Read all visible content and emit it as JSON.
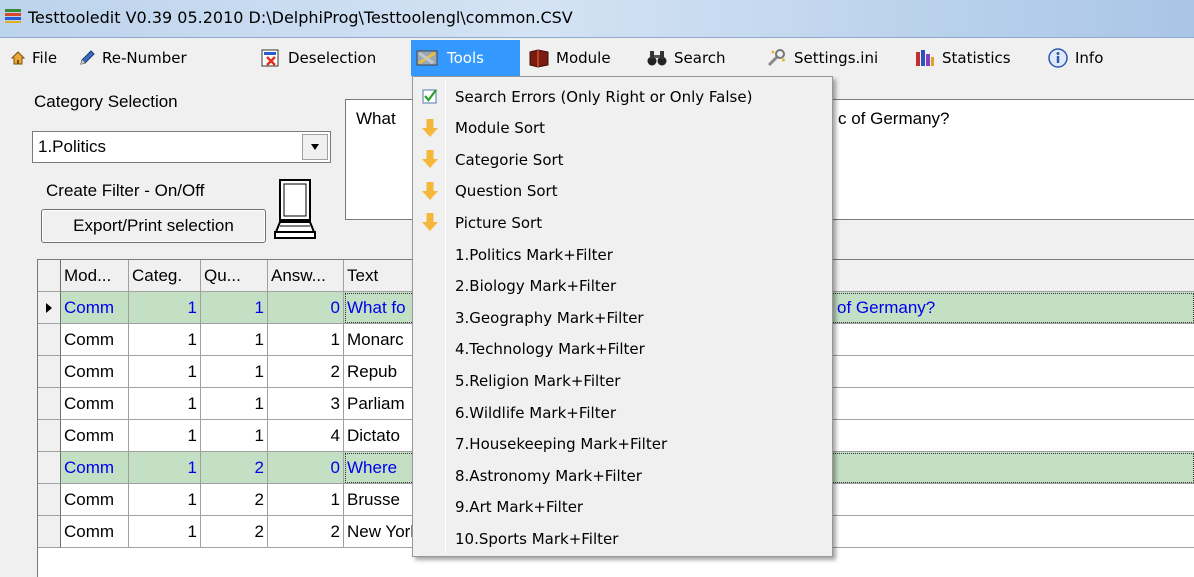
{
  "window": {
    "title": "Testtooledit V0.39 05.2010 D:\\DelphiProg\\Testtoolengl\\common.CSV"
  },
  "menu": {
    "file": "File",
    "renumber": "Re-Number",
    "deselection": "Deselection",
    "tools": "Tools",
    "module": "Module",
    "search": "Search",
    "settings": "Settings.ini",
    "statistics": "Statistics",
    "info": "Info"
  },
  "left_panel": {
    "category_label": "Category Selection",
    "category_value": "1.Politics",
    "filter_label": "Create Filter - On/Off",
    "export_button": "Export/Print selection"
  },
  "question_memo": {
    "text_left": "What",
    "text_right": "c of Germany?"
  },
  "grid": {
    "headers": {
      "module": "Mod...",
      "category": "Categ.",
      "question": "Qu...",
      "answer": "Answ...",
      "text": "Text"
    },
    "rows": [
      {
        "module": "Comm",
        "category": "1",
        "question": "1",
        "answer": "0",
        "text": "What fo",
        "text_tail": "of Germany?",
        "highlight": true,
        "current": true
      },
      {
        "module": "Comm",
        "category": "1",
        "question": "1",
        "answer": "1",
        "text": "Monarc",
        "text_tail": "",
        "highlight": false,
        "current": false
      },
      {
        "module": "Comm",
        "category": "1",
        "question": "1",
        "answer": "2",
        "text": "Repub",
        "text_tail": "",
        "highlight": false,
        "current": false
      },
      {
        "module": "Comm",
        "category": "1",
        "question": "1",
        "answer": "3",
        "text": "Parliam",
        "text_tail": "",
        "highlight": false,
        "current": false
      },
      {
        "module": "Comm",
        "category": "1",
        "question": "1",
        "answer": "4",
        "text": "Dictato",
        "text_tail": "",
        "highlight": false,
        "current": false
      },
      {
        "module": "Comm",
        "category": "1",
        "question": "2",
        "answer": "0",
        "text": "Where",
        "text_tail": "",
        "highlight": true,
        "current": false
      },
      {
        "module": "Comm",
        "category": "1",
        "question": "2",
        "answer": "1",
        "text": "Brusse",
        "text_tail": "",
        "highlight": false,
        "current": false
      },
      {
        "module": "Comm",
        "category": "1",
        "question": "2",
        "answer": "2",
        "text": "New York",
        "text_tail": "",
        "highlight": false,
        "current": false
      }
    ]
  },
  "tools_menu": {
    "items": [
      {
        "label": "Search Errors (Only Right or Only False)",
        "icon": "checkbox-icon"
      },
      {
        "label": "Module Sort",
        "icon": "arrow-down-icon"
      },
      {
        "label": "Categorie Sort",
        "icon": "arrow-down-icon"
      },
      {
        "label": "Question Sort",
        "icon": "arrow-down-icon"
      },
      {
        "label": "Picture Sort",
        "icon": "arrow-down-icon"
      },
      {
        "label": "1.Politics Mark+Filter",
        "icon": ""
      },
      {
        "label": "2.Biology Mark+Filter",
        "icon": ""
      },
      {
        "label": "3.Geography Mark+Filter",
        "icon": ""
      },
      {
        "label": "4.Technology Mark+Filter",
        "icon": ""
      },
      {
        "label": "5.Religion Mark+Filter",
        "icon": ""
      },
      {
        "label": "6.Wildlife Mark+Filter",
        "icon": ""
      },
      {
        "label": "7.Housekeeping Mark+Filter",
        "icon": ""
      },
      {
        "label": "8.Astronomy Mark+Filter",
        "icon": ""
      },
      {
        "label": "9.Art Mark+Filter",
        "icon": ""
      },
      {
        "label": "10.Sports Mark+Filter",
        "icon": ""
      }
    ]
  },
  "colors": {
    "menu_highlight": "#3399ff",
    "row_highlight": "#c3dfc4",
    "highlight_text": "#0000ee",
    "sort_arrow": "#f5b73b"
  }
}
